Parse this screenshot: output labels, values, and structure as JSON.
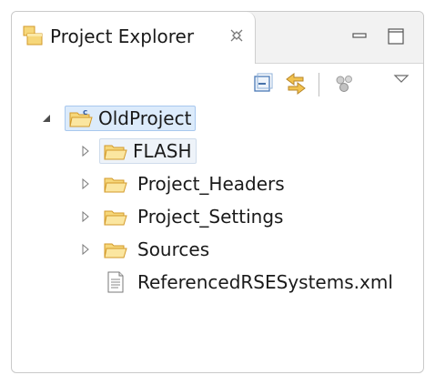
{
  "view": {
    "tab_title": "Project Explorer",
    "tab_icon": "project-explorer-icon",
    "close_icon": "close-tab-icon"
  },
  "window_controls": [
    "minimize-icon",
    "maximize-icon"
  ],
  "toolbar": [
    "collapse-all-icon",
    "link-with-editor-icon",
    "focus-on-working-set-icon",
    "view-menu-icon"
  ],
  "tree": {
    "root": {
      "label": "OldProject",
      "icon": "c-project-folder-icon",
      "expanded": true,
      "selected": true
    },
    "children": [
      {
        "label": "FLASH",
        "icon": "folder-icon",
        "expandable": true
      },
      {
        "label": "Project_Headers",
        "icon": "folder-icon",
        "expandable": true
      },
      {
        "label": "Project_Settings",
        "icon": "folder-icon",
        "expandable": true
      },
      {
        "label": "Sources",
        "icon": "folder-icon",
        "expandable": true
      },
      {
        "label": "ReferencedRSESystems.xml",
        "icon": "xml-file-icon",
        "expandable": false
      }
    ]
  },
  "colors": {
    "folder": "#f6d77a",
    "folder_outline": "#d39a2a",
    "selection": "#dcebfb",
    "selection_border": "#a8c8ee"
  }
}
